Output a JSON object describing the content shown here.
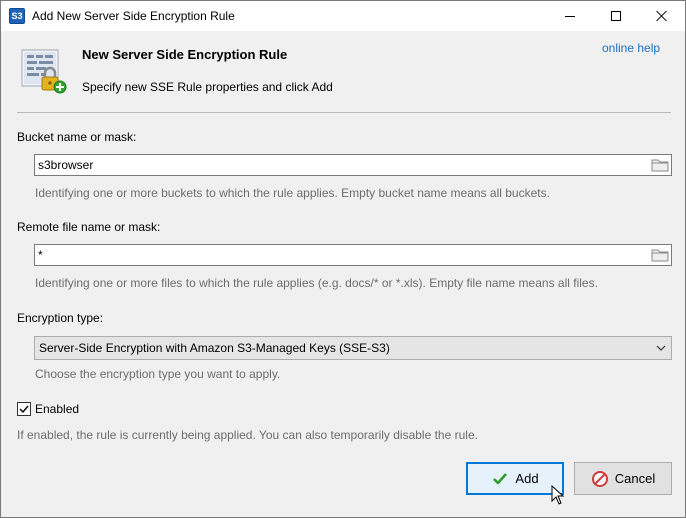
{
  "window": {
    "title": "Add New Server Side Encryption Rule",
    "app_icon_text": "S3"
  },
  "header": {
    "title": "New Server Side Encryption Rule",
    "subtitle": "Specify new SSE Rule properties and click Add",
    "help_link": "online help"
  },
  "bucket": {
    "label": "Bucket name or mask:",
    "value": "s3browser",
    "hint": "Identifying one or more buckets to which the rule applies. Empty bucket name means all buckets."
  },
  "remote": {
    "label": "Remote file name or mask:",
    "value": "*",
    "hint": "Identifying one or more files to which the rule applies (e.g. docs/* or *.xls). Empty file name means all files."
  },
  "encryption": {
    "label": "Encryption type:",
    "selected": "Server-Side Encryption with Amazon S3-Managed Keys (SSE-S3)",
    "hint": "Choose the encryption type you want to apply."
  },
  "enabled": {
    "label": "Enabled",
    "checked": true,
    "hint": "If enabled, the rule is currently being applied. You can also temporarily disable the rule."
  },
  "buttons": {
    "add": "Add",
    "cancel": "Cancel"
  },
  "colors": {
    "link": "#1a6fc4",
    "accent": "#0078d7",
    "hint_text": "#6d6d6d"
  }
}
